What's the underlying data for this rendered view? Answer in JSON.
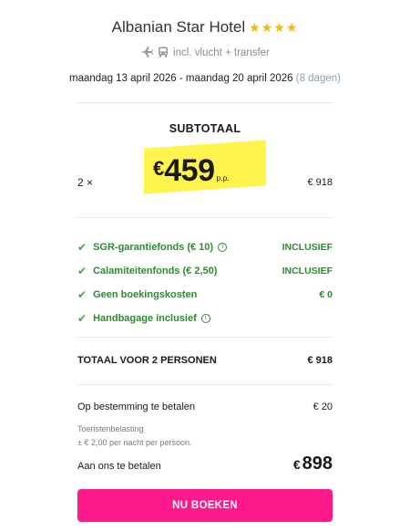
{
  "hotel": {
    "name": "Albanian Star Hotel",
    "stars": "★★★★"
  },
  "transport": {
    "text": "incl. vlucht + transfer"
  },
  "dates": {
    "range": "maandag 13 april 2026 - maandag 20 april 2026",
    "nights": "(8 dagen)"
  },
  "subtotal": {
    "label": "SUBTOTAAL",
    "quantity": "2 ×",
    "currency": "€",
    "price": "459",
    "per_person": "p.p.",
    "line_total": "€ 918"
  },
  "perks": [
    {
      "label": "SGR-garantiefonds (€ 10)",
      "info": true,
      "value": "INCLUSIEF"
    },
    {
      "label": "Calamiteitenfonds (€ 2,50)",
      "info": false,
      "value": "INCLUSIEF"
    },
    {
      "label": "Geen boekingskosten",
      "info": false,
      "value": "€ 0"
    },
    {
      "label": "Handbagage inclusief",
      "info": true,
      "value": ""
    }
  ],
  "total": {
    "label": "TOTAAL VOOR 2 PERSONEN",
    "value": "€ 918"
  },
  "destination": {
    "label": "Op bestemming te betalen",
    "value": "€ 20",
    "tax_label": "Toeristenbelasting",
    "tax_note": "± € 2,00 per nacht per persoon."
  },
  "payment": {
    "label": "Aan ons te betalen",
    "currency": "€",
    "amount": "898"
  },
  "cta": {
    "label": "NU BOEKEN"
  },
  "colors": {
    "accent": "#ff1a8c",
    "success": "#2b8c2b",
    "highlight": "#fff34d",
    "star": "#f5b800"
  },
  "icons": {
    "flight": "plane-icon",
    "bus": "bus-icon",
    "check": "check-icon",
    "info": "info-icon"
  }
}
